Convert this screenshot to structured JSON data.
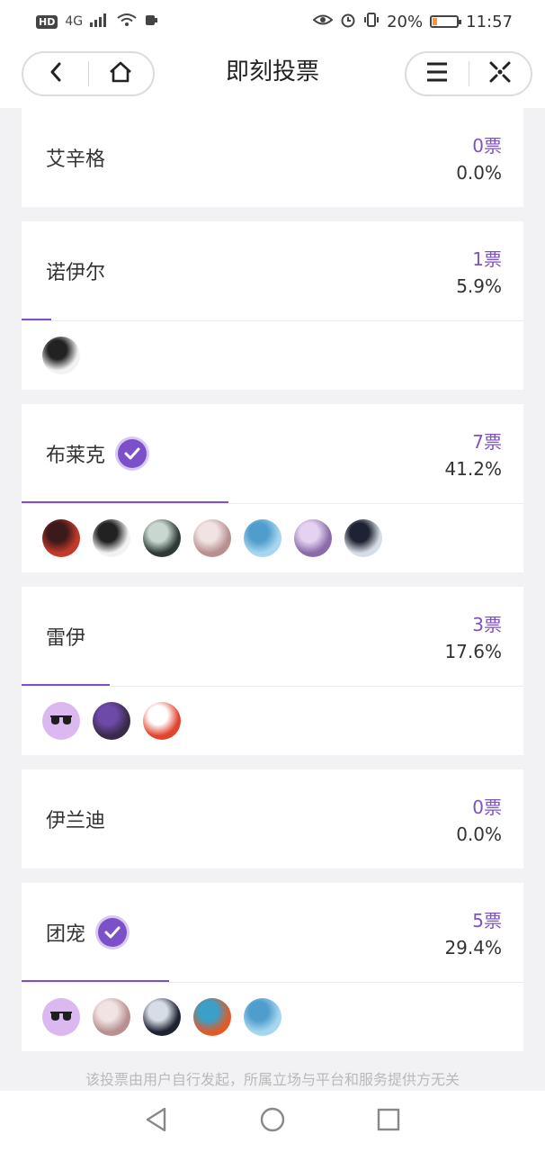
{
  "status_bar": {
    "hd": "HD",
    "network": "4G",
    "battery_text": "20%",
    "battery_level": 0.2,
    "time": "11:57"
  },
  "header": {
    "title": "即刻投票",
    "back_icon": "chevron-left-icon",
    "home_icon": "home-icon",
    "menu_icon": "menu-icon",
    "close_icon": "close-icon"
  },
  "options": [
    {
      "name": "艾辛格",
      "votes": "0票",
      "percent": "0.0%",
      "progress": 0.0,
      "selected": false,
      "voters": []
    },
    {
      "name": "诺伊尔",
      "votes": "1票",
      "percent": "5.9%",
      "progress": 0.059,
      "selected": false,
      "voters": [
        {
          "colors": [
            "#f2f2f2",
            "#222222"
          ]
        }
      ]
    },
    {
      "name": "布莱克",
      "votes": "7票",
      "percent": "41.2%",
      "progress": 0.412,
      "selected": true,
      "voters": [
        {
          "colors": [
            "#c43a2a",
            "#3a1a1a"
          ]
        },
        {
          "colors": [
            "#f2f2f2",
            "#222222"
          ]
        },
        {
          "colors": [
            "#2f3a36",
            "#c8d8cf"
          ]
        },
        {
          "colors": [
            "#b89090",
            "#f1e3e3"
          ]
        },
        {
          "colors": [
            "#a8d6ef",
            "#4f9dcc"
          ]
        },
        {
          "colors": [
            "#8a6aa8",
            "#e4d2f0"
          ]
        },
        {
          "colors": [
            "#d7dde6",
            "#1e2232"
          ]
        }
      ]
    },
    {
      "name": "雷伊",
      "votes": "3票",
      "percent": "17.6%",
      "progress": 0.176,
      "selected": false,
      "voters": [
        {
          "type": "glasses"
        },
        {
          "colors": [
            "#3a2a4a",
            "#6d4aa8"
          ]
        },
        {
          "colors": [
            "#e0452f",
            "#ffffff"
          ]
        }
      ]
    },
    {
      "name": "伊兰迪",
      "votes": "0票",
      "percent": "0.0%",
      "progress": 0.0,
      "selected": false,
      "voters": []
    },
    {
      "name": "团宠",
      "votes": "5票",
      "percent": "29.4%",
      "progress": 0.294,
      "selected": true,
      "voters": [
        {
          "type": "glasses"
        },
        {
          "colors": [
            "#b89090",
            "#f1e3e3"
          ]
        },
        {
          "colors": [
            "#1e2232",
            "#d7dde6"
          ]
        },
        {
          "colors": [
            "#e05a2a",
            "#3aa0c8"
          ]
        },
        {
          "colors": [
            "#a8d6ef",
            "#4f9dcc"
          ]
        }
      ]
    }
  ],
  "check_icon": "check-icon",
  "disclaimer": "该投票由用户自行发起，所属立场与平台和服务提供方无关",
  "nav": {
    "back_icon": "triangle-back-icon",
    "home_icon": "circle-home-icon",
    "recents_icon": "square-recents-icon"
  },
  "colors": {
    "accent": "#7d52c6",
    "background": "#f2f2f4",
    "battery": "#f29a3a"
  }
}
